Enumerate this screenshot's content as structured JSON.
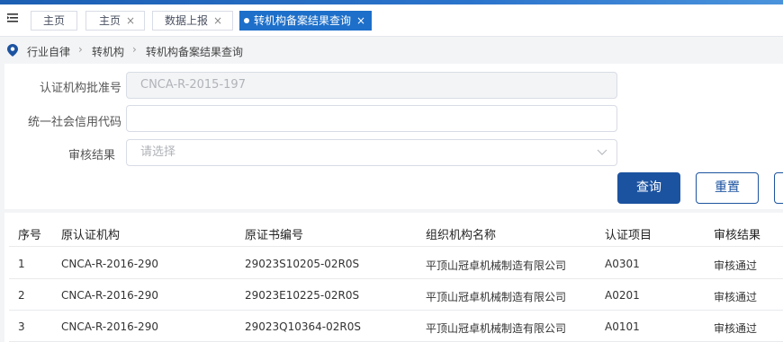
{
  "tabs": [
    {
      "label": "主页",
      "closable": false
    },
    {
      "label": "主页",
      "closable": true
    },
    {
      "label": "数据上报",
      "closable": true
    },
    {
      "label": "转机构备案结果查询",
      "closable": true,
      "active": true
    }
  ],
  "close_glyph": "×",
  "breadcrumb": [
    "行业自律",
    "转机构",
    "转机构备案结果查询"
  ],
  "breadcrumb_sep": "›",
  "form": {
    "approval_label": "认证机构批准号",
    "approval_value": "CNCA-R-2015-197",
    "credit_label": "统一社会信用代码",
    "credit_value": "",
    "review_label": "审核结果",
    "review_placeholder": "请选择"
  },
  "buttons": {
    "query": "查询",
    "reset": "重置"
  },
  "table": {
    "headers": [
      "序号",
      "原认证机构",
      "原证书编号",
      "组织机构名称",
      "认证项目",
      "审核结果"
    ],
    "rows": [
      [
        "1",
        "CNCA-R-2016-290",
        "29023S10205-02R0S",
        "平顶山冠卓机械制造有限公司",
        "A0301",
        "审核通过"
      ],
      [
        "2",
        "CNCA-R-2016-290",
        "29023E10225-02R0S",
        "平顶山冠卓机械制造有限公司",
        "A0201",
        "审核通过"
      ],
      [
        "3",
        "CNCA-R-2016-290",
        "29023Q10364-02R0S",
        "平顶山冠卓机械制造有限公司",
        "A0101",
        "审核通过"
      ]
    ]
  },
  "colors": {
    "primary": "#1c53a0",
    "active_tab": "#1d6fc9",
    "header_strip": "#2b74cc"
  }
}
